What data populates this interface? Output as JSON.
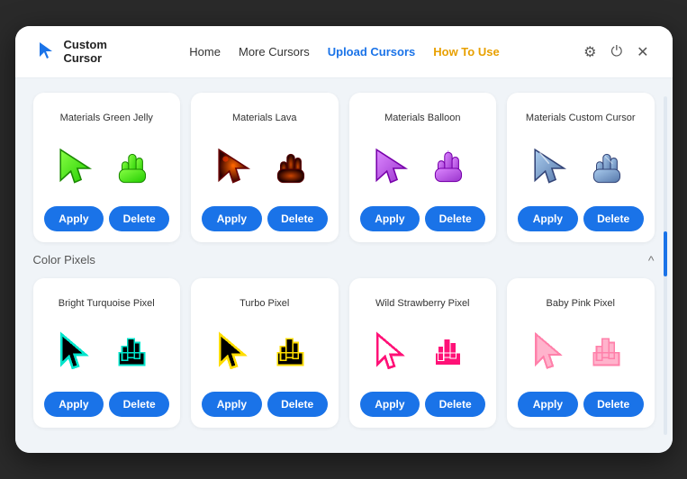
{
  "header": {
    "logo_text_line1": "Custom",
    "logo_text_line2": "Cursor",
    "nav": [
      {
        "label": "Home",
        "active": false,
        "highlight": false
      },
      {
        "label": "More Cursors",
        "active": false,
        "highlight": false
      },
      {
        "label": "Upload Cursors",
        "active": true,
        "highlight": false
      },
      {
        "label": "How To Use",
        "active": false,
        "highlight": true
      }
    ],
    "icons": [
      "gear",
      "power",
      "close"
    ]
  },
  "sections": [
    {
      "id": "materials",
      "label": "",
      "cards": [
        {
          "title": "Materials Green Jelly",
          "apply_label": "Apply",
          "delete_label": "Delete",
          "theme": "green"
        },
        {
          "title": "Materials Lava",
          "apply_label": "Apply",
          "delete_label": "Delete",
          "theme": "dark"
        },
        {
          "title": "Materials Balloon",
          "apply_label": "Apply",
          "delete_label": "Delete",
          "theme": "purple"
        },
        {
          "title": "Materials Custom Cursor",
          "apply_label": "Apply",
          "delete_label": "Delete",
          "theme": "crystal"
        }
      ]
    },
    {
      "id": "color-pixels",
      "label": "Color Pixels",
      "chevron": "^",
      "cards": [
        {
          "title": "Bright Turquoise Pixel",
          "apply_label": "Apply",
          "delete_label": "Delete",
          "theme": "turquoise"
        },
        {
          "title": "Turbo Pixel",
          "apply_label": "Apply",
          "delete_label": "Delete",
          "theme": "yellow"
        },
        {
          "title": "Wild Strawberry Pixel",
          "apply_label": "Apply",
          "delete_label": "Delete",
          "theme": "strawberry"
        },
        {
          "title": "Baby Pink Pixel",
          "apply_label": "Apply",
          "delete_label": "Delete",
          "theme": "pink"
        }
      ]
    }
  ]
}
